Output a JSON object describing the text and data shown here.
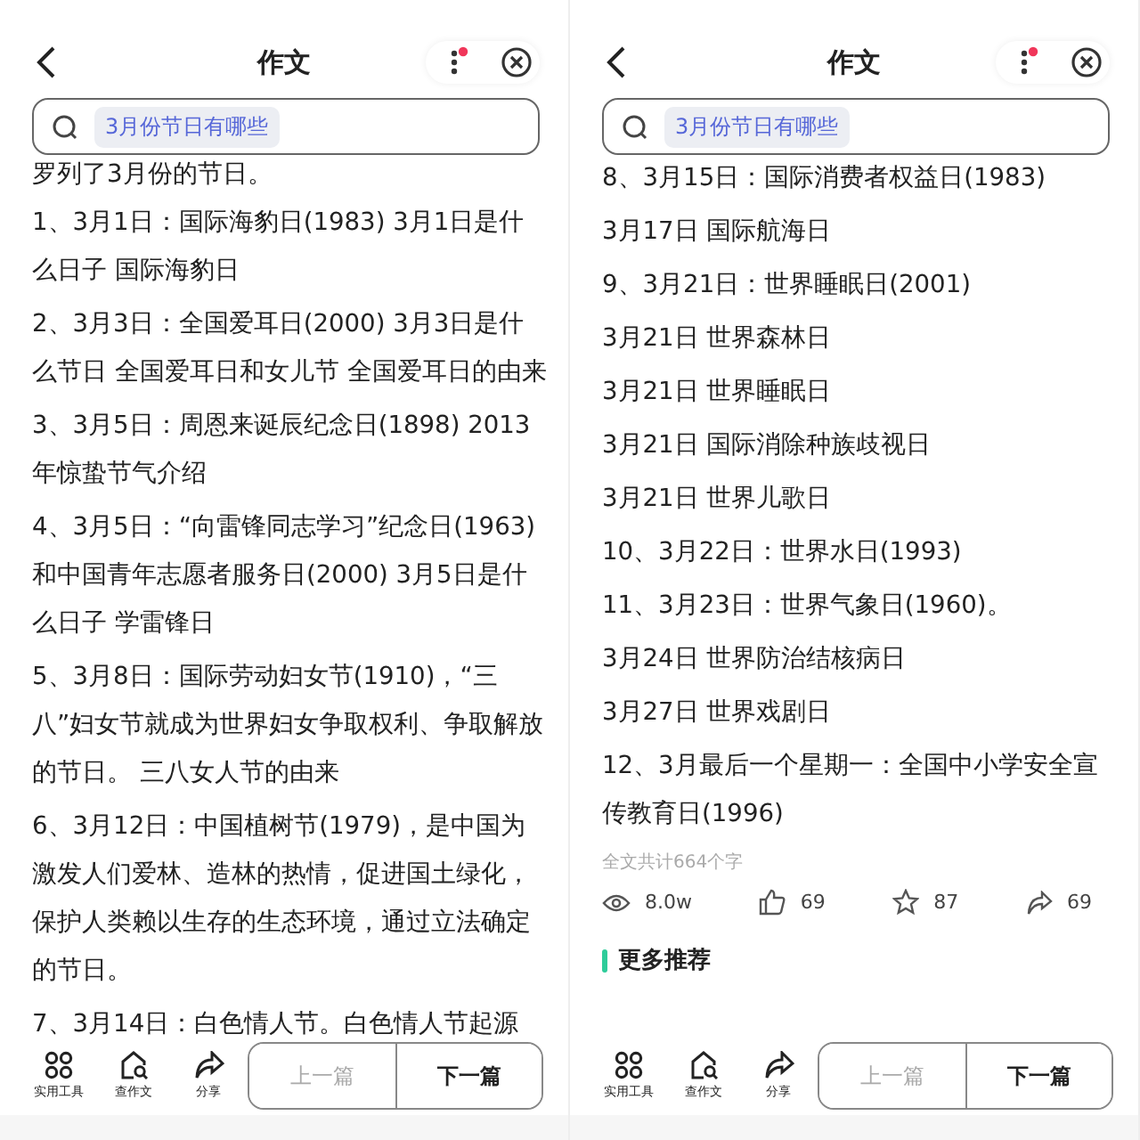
{
  "panels": [
    {
      "title": "作文",
      "search": {
        "query": "3月份节日有哪些"
      },
      "menu_badge": true,
      "paragraphs": [
        "罗列了3月份的节日。",
        "1、3月1日：国际海豹日(1983) 3月1日是什么日子 国际海豹日",
        "2、3月3日：全国爱耳日(2000) 3月3日是什么节日 全国爱耳日和女儿节 全国爱耳日的由来",
        "3、3月5日：周恩来诞辰纪念日(1898) 2013年惊蛰节气介绍",
        "4、3月5日：“向雷锋同志学习”纪念日(1963)和中国青年志愿者服务日(2000) 3月5日是什么日子 学雷锋日",
        "5、3月8日：国际劳动妇女节(1910)，“三八”妇女节就成为世界妇女争取权利、争取解放的节日。 三八女人节的由来",
        "6、3月12日：中国植树节(1979)，是中国为激发人们爱林、造林的热情，促进国土绿化，保护人类赖以生存的生态环境，通过立法确定的节日。",
        "7、3月14日：白色情人节。白色情人节起源"
      ],
      "tools": [
        "实用工具",
        "查作文",
        "分享"
      ],
      "nav": [
        {
          "label": "上一篇",
          "disabled": true
        },
        {
          "label": "下一篇",
          "disabled": false
        }
      ]
    },
    {
      "title": "作文",
      "search": {
        "query": "3月份节日有哪些"
      },
      "menu_badge": true,
      "paragraphs": [
        "8、3月15日：国际消费者权益日(1983)",
        "3月17日 国际航海日",
        "9、3月21日：世界睡眠日(2001)",
        "3月21日 世界森林日",
        "3月21日 世界睡眠日",
        "3月21日 国际消除种族歧视日",
        "3月21日 世界儿歌日",
        "10、3月22日：世界水日(1993)",
        "11、3月23日：世界气象日(1960)。",
        "3月24日 世界防治结核病日",
        "3月27日 世界戏剧日",
        "12、3月最后一个星期一：全国中小学安全宣传教育日(1996)"
      ],
      "word_count": "全文共计664个字",
      "stats": {
        "views": "8.0w",
        "likes": "69",
        "favorites": "87",
        "shares": "69"
      },
      "more_heading": "更多推荐",
      "tools": [
        "实用工具",
        "查作文",
        "分享"
      ],
      "nav": [
        {
          "label": "上一篇",
          "disabled": true
        },
        {
          "label": "下一篇",
          "disabled": false
        }
      ]
    }
  ]
}
